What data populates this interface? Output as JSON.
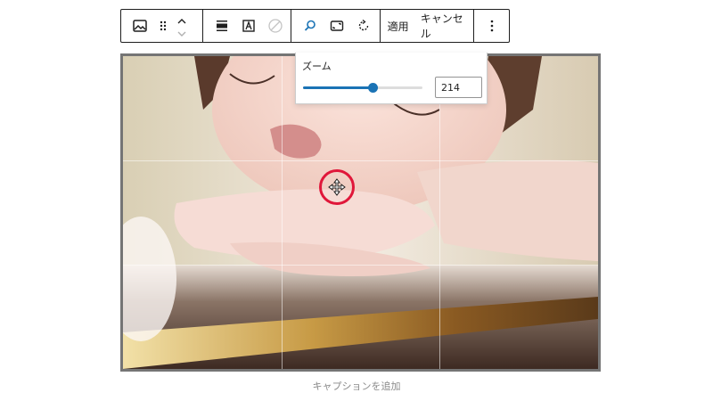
{
  "toolbar": {
    "apply_label": "適用",
    "cancel_label": "キャンセル",
    "icons": [
      "image-icon",
      "drag-icon",
      "move-up-icon",
      "move-down-icon",
      "align-icon",
      "text-overlay-icon",
      "duotone-icon",
      "search-icon",
      "aspect-ratio-icon",
      "rotate-icon",
      "more-options-icon"
    ]
  },
  "zoom": {
    "label": "ズーム",
    "value": "214",
    "slider_fraction": 0.58
  },
  "caption": {
    "placeholder": "キャプションを追加"
  },
  "colors": {
    "accent": "#1a73b5",
    "handle": "#e0173a",
    "border": "#1e1e1e"
  }
}
